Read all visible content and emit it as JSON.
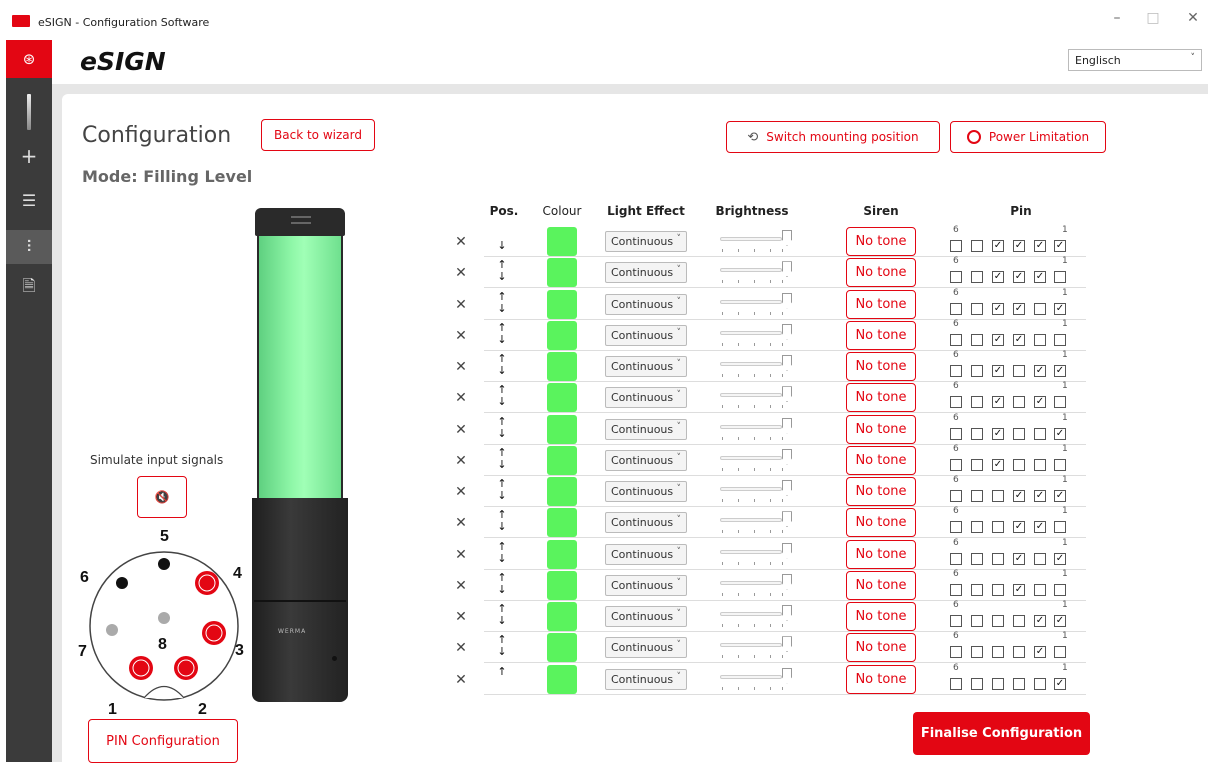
{
  "window": {
    "title": "eSIGN - Configuration Software",
    "minimize": "–",
    "maximize": "□",
    "close": "✕"
  },
  "app": {
    "name": "eSIGN",
    "language": "Englisch"
  },
  "sidebar": {
    "items": [
      {
        "icon": "logo-icon",
        "glyph": "⊛"
      },
      {
        "icon": "plus-icon",
        "glyph": "+"
      },
      {
        "icon": "list-icon",
        "glyph": "☰"
      },
      {
        "icon": "sliders-icon",
        "glyph": "⫶"
      },
      {
        "icon": "document-icon",
        "glyph": "🗎"
      }
    ]
  },
  "page": {
    "title": "Configuration",
    "mode": "Mode: Filling Level",
    "back_button": "Back to wizard",
    "switch_button": "Switch mounting position",
    "power_button": "Power Limitation",
    "simulate_label": "Simulate input signals",
    "mute_glyph": "🔇",
    "pin_config_button": "PIN Configuration",
    "finalise_button": "Finalise Configuration",
    "tower_brand": "WERMA"
  },
  "connector": {
    "labels": [
      "1",
      "2",
      "3",
      "4",
      "5",
      "6",
      "7",
      "8"
    ],
    "active_pins": [
      "1",
      "2",
      "3",
      "4"
    ]
  },
  "table": {
    "headers": {
      "pos": "Pos.",
      "colour": "Colour",
      "effect": "Light Effect",
      "brightness": "Brightness",
      "siren": "Siren",
      "pin": "Pin"
    },
    "pin_label_left": "6",
    "pin_label_right": "1",
    "colour_hex": "#5af35d",
    "rows": [
      {
        "pos": "↓",
        "effect": "Continuous",
        "siren": "No tone",
        "pins": [
          0,
          0,
          1,
          1,
          1,
          1
        ]
      },
      {
        "pos": "↑↓",
        "effect": "Continuous",
        "siren": "No tone",
        "pins": [
          0,
          0,
          1,
          1,
          1,
          0
        ]
      },
      {
        "pos": "↑↓",
        "effect": "Continuous",
        "siren": "No tone",
        "pins": [
          0,
          0,
          1,
          1,
          0,
          1
        ]
      },
      {
        "pos": "↑↓",
        "effect": "Continuous",
        "siren": "No tone",
        "pins": [
          0,
          0,
          1,
          1,
          0,
          0
        ]
      },
      {
        "pos": "↑↓",
        "effect": "Continuous",
        "siren": "No tone",
        "pins": [
          0,
          0,
          1,
          0,
          1,
          1
        ]
      },
      {
        "pos": "↑↓",
        "effect": "Continuous",
        "siren": "No tone",
        "pins": [
          0,
          0,
          1,
          0,
          1,
          0
        ]
      },
      {
        "pos": "↑↓",
        "effect": "Continuous",
        "siren": "No tone",
        "pins": [
          0,
          0,
          1,
          0,
          0,
          1
        ]
      },
      {
        "pos": "↑↓",
        "effect": "Continuous",
        "siren": "No tone",
        "pins": [
          0,
          0,
          1,
          0,
          0,
          0
        ]
      },
      {
        "pos": "↑↓",
        "effect": "Continuous",
        "siren": "No tone",
        "pins": [
          0,
          0,
          0,
          1,
          1,
          1
        ]
      },
      {
        "pos": "↑↓",
        "effect": "Continuous",
        "siren": "No tone",
        "pins": [
          0,
          0,
          0,
          1,
          1,
          0
        ]
      },
      {
        "pos": "↑↓",
        "effect": "Continuous",
        "siren": "No tone",
        "pins": [
          0,
          0,
          0,
          1,
          0,
          1
        ]
      },
      {
        "pos": "↑↓",
        "effect": "Continuous",
        "siren": "No tone",
        "pins": [
          0,
          0,
          0,
          1,
          0,
          0
        ]
      },
      {
        "pos": "↑↓",
        "effect": "Continuous",
        "siren": "No tone",
        "pins": [
          0,
          0,
          0,
          0,
          1,
          1
        ]
      },
      {
        "pos": "↑↓",
        "effect": "Continuous",
        "siren": "No tone",
        "pins": [
          0,
          0,
          0,
          0,
          1,
          0
        ]
      },
      {
        "pos": "↑",
        "effect": "Continuous",
        "siren": "No tone",
        "pins": [
          0,
          0,
          0,
          0,
          0,
          1
        ]
      }
    ]
  }
}
